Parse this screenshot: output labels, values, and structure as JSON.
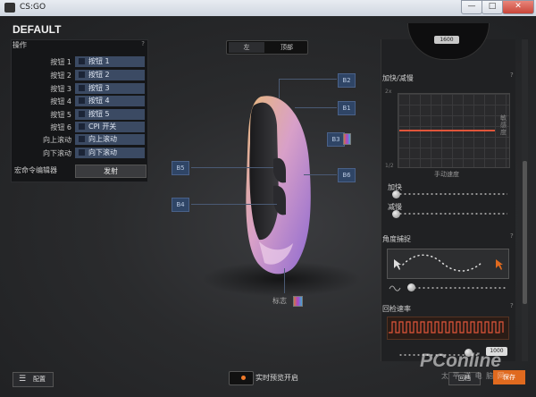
{
  "window": {
    "title": "CS:GO",
    "min": "—",
    "max": "□",
    "close": "✕"
  },
  "profile_title": "DEFAULT",
  "operations": {
    "header": "操作",
    "help": "?",
    "buttons": [
      {
        "name": "按钮 1",
        "value": "按钮 1"
      },
      {
        "name": "按钮 2",
        "value": "按钮 2"
      },
      {
        "name": "按钮 3",
        "value": "按钮 3"
      },
      {
        "name": "按钮 4",
        "value": "按钮 4"
      },
      {
        "name": "按钮 5",
        "value": "按钮 5"
      },
      {
        "name": "按钮 6",
        "value": "CPI 开关"
      },
      {
        "name": "向上滚动",
        "value": "向上滚动"
      },
      {
        "name": "向下滚动",
        "value": "向下滚动"
      }
    ],
    "macro_label": "宏命令编辑器",
    "macro_button": "发射"
  },
  "view_tabs": {
    "left": "左",
    "top": "顶部"
  },
  "badges": {
    "b1": "B1",
    "b2": "B2",
    "b3": "B3",
    "b4": "B4",
    "b5": "B5",
    "b6": "B6"
  },
  "logo_label": "标志",
  "right": {
    "dpi_value": "1600",
    "accel_title": "加快/减慢",
    "accel_help": "?",
    "graph_y_top": "2x",
    "graph_y_bottom": "1/2",
    "graph_right_label": "敏感度",
    "graph_xlabel": "手动速度",
    "accel_label": "加快",
    "decel_label": "减慢",
    "angle_title": "角度捕捉",
    "angle_help": "?",
    "poll_title": "回检速率",
    "poll_help": "?",
    "poll_value": "1000"
  },
  "bottom": {
    "config_label": "配置",
    "live_label": "实时预览开启",
    "revert_label": "回档",
    "save_label": "保存"
  },
  "watermark": {
    "main": "PConline",
    "sub": "太 平 洋 电 脑 网"
  },
  "colors": {
    "accent": "#e06a1f",
    "badge": "#2f4566",
    "graph_line": "#e0553a"
  }
}
